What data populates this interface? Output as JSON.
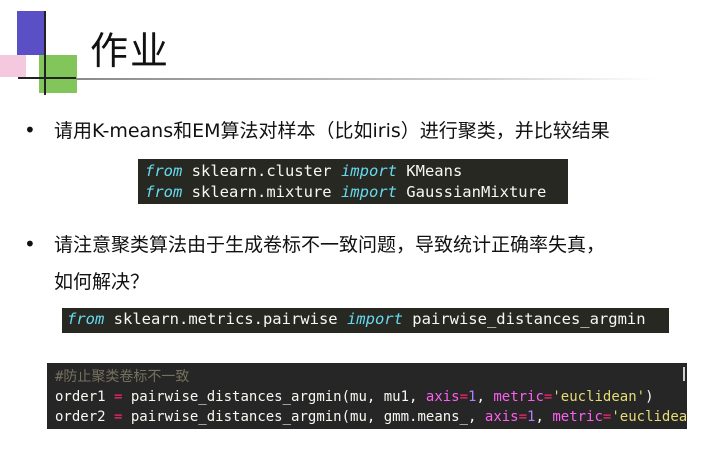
{
  "slide": {
    "title": "作业",
    "bullets": [
      {
        "marker": "•",
        "text": "请用K-means和EM算法对样本（比如iris）进行聚类，并比较结果"
      },
      {
        "marker": "•",
        "line1": "请注意聚类算法由于生成卷标不一致问题，导致统计正确率失真，",
        "line2": "如何解决？"
      }
    ]
  },
  "code_block_1": {
    "line1": {
      "kw1": "from",
      "module": " sklearn.cluster ",
      "kw2": "import",
      "name": " KMeans"
    },
    "line2": {
      "kw1": "from",
      "module": " sklearn.mixture ",
      "kw2": "import",
      "name": " GaussianMixture"
    }
  },
  "code_block_2": {
    "line1": {
      "kw1": "from",
      "module": " sklearn.metrics.pairwise ",
      "kw2": "import",
      "name": " pairwise_distances_argmin"
    }
  },
  "code_block_3": {
    "comment": "#防止聚类卷标不一致",
    "line1": {
      "lhs": "order1 ",
      "eq": "=",
      "call": " pairwise_distances_argmin(mu, mu1, ",
      "axis_kw": "axis",
      "eq2": "=",
      "axis_val": "1",
      "sep": ", ",
      "metric_kw": "metric",
      "eq3": "=",
      "metric_val": "'euclidean'",
      "close": ")"
    },
    "line2": {
      "lhs": "order2 ",
      "eq": "=",
      "call": " pairwise_distances_argmin(mu, gmm.means_, ",
      "axis_kw": "axis",
      "eq2": "=",
      "axis_val": "1",
      "sep": ", ",
      "metric_kw": "metric",
      "eq3": "=",
      "metric_val": "'euclidean'",
      "close": ")"
    }
  }
}
